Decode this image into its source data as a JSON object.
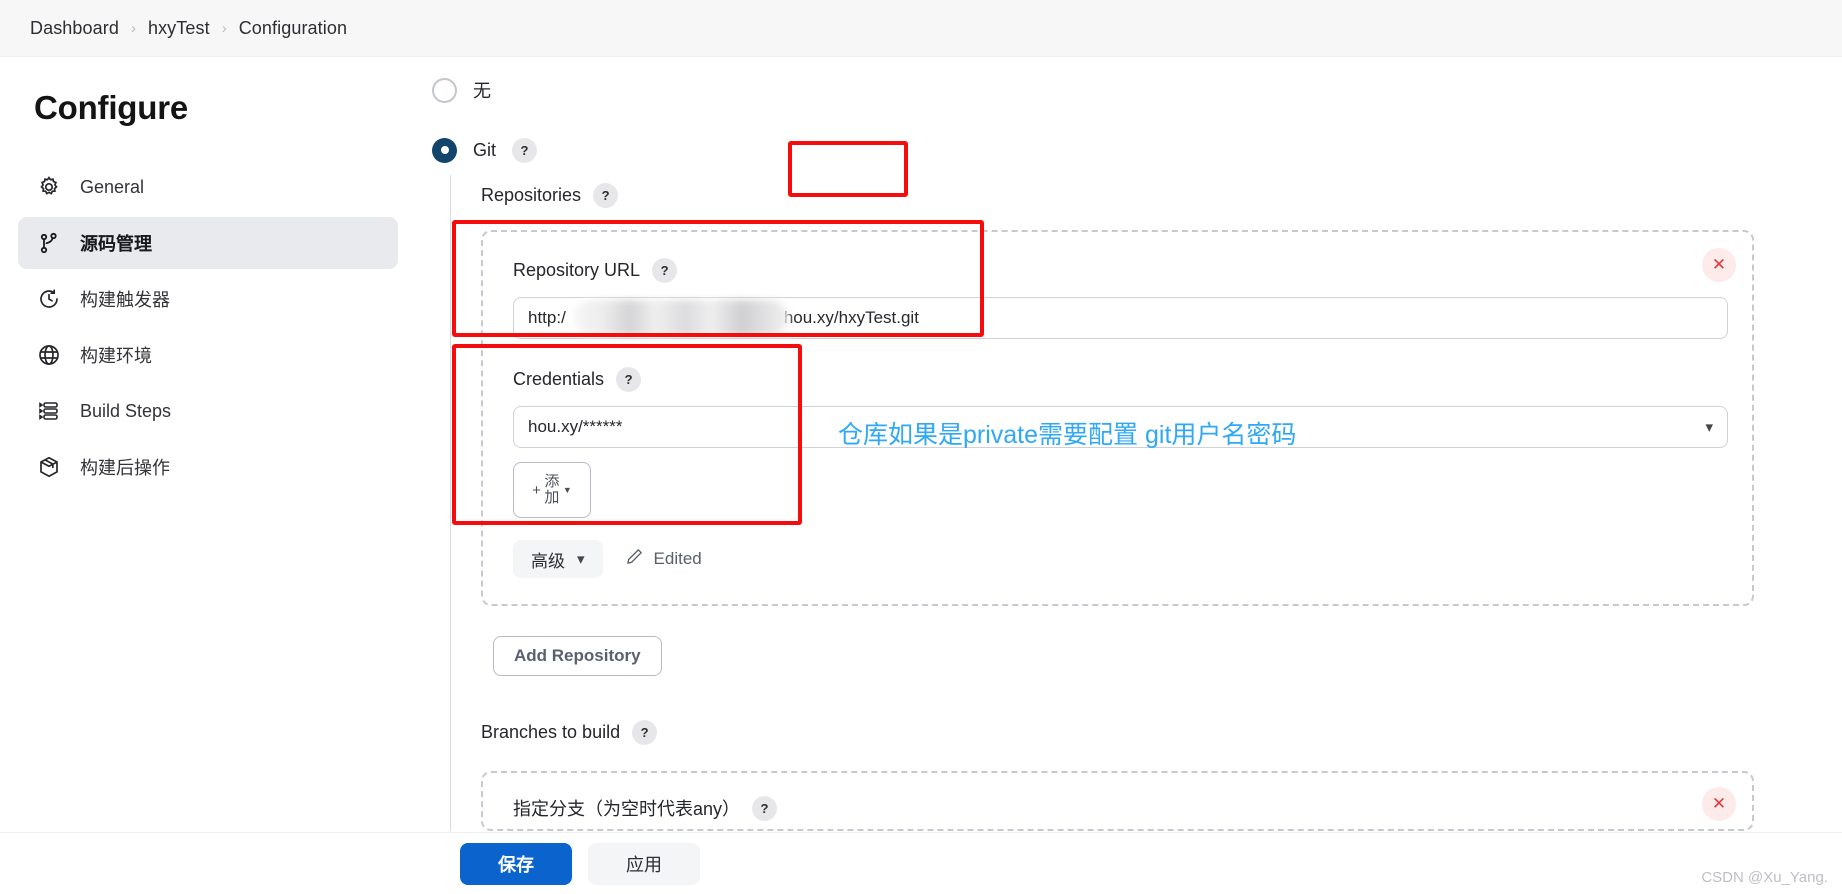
{
  "breadcrumb": {
    "items": [
      "Dashboard",
      "hxyTest",
      "Configuration"
    ],
    "separator": "›"
  },
  "sidebar": {
    "title": "Configure",
    "items": [
      {
        "label": "General",
        "icon": "gear-icon",
        "active": false
      },
      {
        "label": "源码管理",
        "icon": "source-branch-icon",
        "active": true
      },
      {
        "label": "构建触发器",
        "icon": "clock-icon",
        "active": false
      },
      {
        "label": "构建环境",
        "icon": "globe-icon",
        "active": false
      },
      {
        "label": "Build Steps",
        "icon": "list-steps-icon",
        "active": false
      },
      {
        "label": "构建后操作",
        "icon": "package-icon",
        "active": false
      }
    ]
  },
  "scm": {
    "options": [
      {
        "label": "无",
        "checked": false,
        "has_help": false
      },
      {
        "label": "Git",
        "checked": true,
        "has_help": true
      }
    ],
    "repositories_label": "Repositories",
    "repo": {
      "url_label": "Repository URL",
      "url_value_prefix": "http:/",
      "url_value_suffix": "hou.xy/hxyTest.git",
      "credentials_label": "Credentials",
      "credentials_value": "hou.xy/******",
      "add_button_label": "添加",
      "add_button_plus": "+",
      "advanced_label": "高级",
      "edited_label": "Edited",
      "delete_icon": "✕"
    },
    "add_repository_label": "Add Repository",
    "branches_label": "Branches to build",
    "branch_spec_label": "指定分支（为空时代表any）",
    "help_glyph": "?"
  },
  "annotation": {
    "note_text": "仓库如果是private需要配置 git用户名密码",
    "note_color": "#2fa8f5",
    "box_color": "#f50d0d"
  },
  "footer": {
    "save_label": "保存",
    "apply_label": "应用"
  },
  "watermark": "CSDN @Xu_Yang."
}
